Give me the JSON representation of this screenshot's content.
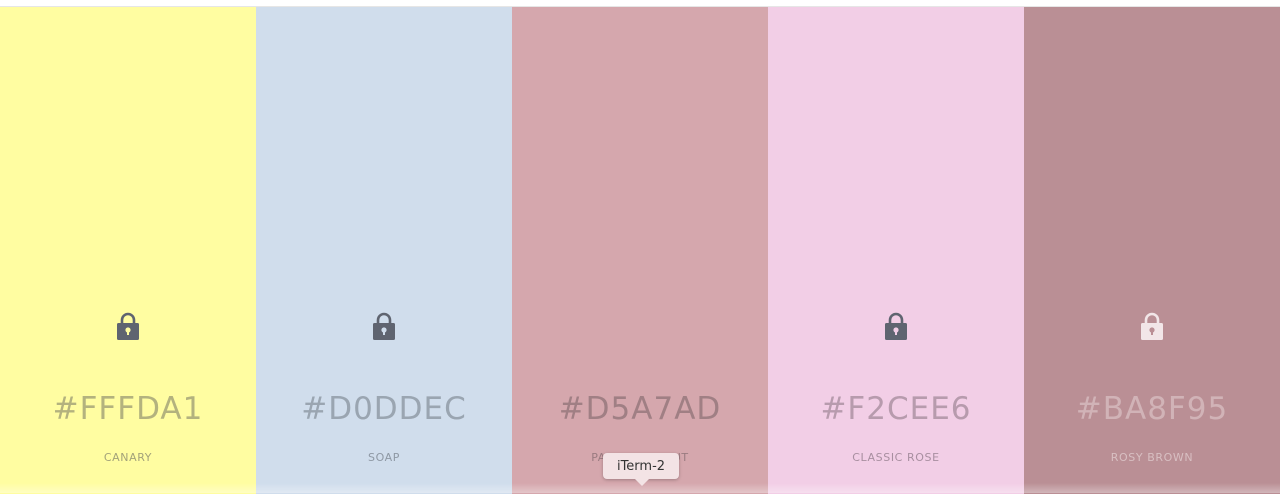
{
  "palette": {
    "swatches": [
      {
        "hex": "#FFFDA1",
        "name": "CANARY",
        "color": "#FFFDA1",
        "text_color": "#b3b27e",
        "name_color": "#a3a27a",
        "lock_color": "#5f6470",
        "lock_icon": "lock-icon"
      },
      {
        "hex": "#D0DDEC",
        "name": "SOAP",
        "color": "#D0DDEC",
        "text_color": "#9aa5b1",
        "name_color": "#8e98a4",
        "lock_color": "#5f6470",
        "lock_icon": "lock-icon"
      },
      {
        "hex": "#D5A7AD",
        "name": "PALE CHESTNUT",
        "color": "#D5A7AD",
        "text_color": "#a07f84",
        "name_color": "#9a7b80",
        "lock_color": "#5f6470",
        "lock_icon": "lock-icon"
      },
      {
        "hex": "#F2CEE6",
        "name": "CLASSIC ROSE",
        "color": "#F2CEE6",
        "text_color": "#b79bad",
        "name_color": "#a88fa0",
        "lock_color": "#5f6470",
        "lock_icon": "lock-icon"
      },
      {
        "hex": "#BA8F95",
        "name": "ROSY BROWN",
        "color": "#BA8F95",
        "text_color": "#d1b3b7",
        "name_color": "#d8bfc2",
        "lock_color": "#f2e6e8",
        "lock_icon": "lock-icon"
      }
    ]
  },
  "tooltip": {
    "label": "iTerm-2"
  }
}
